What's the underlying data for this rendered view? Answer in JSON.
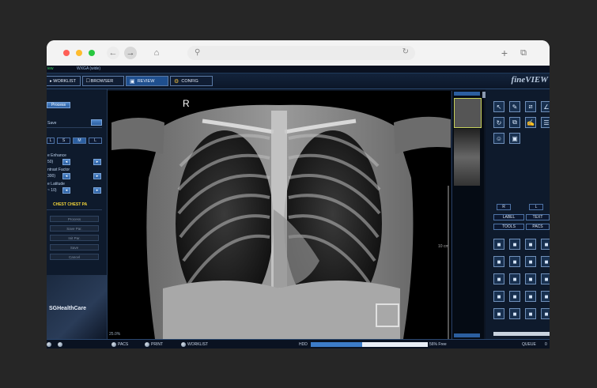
{
  "app": {
    "brand": "fineVIEW",
    "top_strip_left": "iew",
    "top_strip_center": "WXGA (wide)"
  },
  "tabs": [
    "WORKLIST",
    "BROWSER",
    "REVIEW",
    "CONFIG"
  ],
  "left_panel": {
    "process": "Process",
    "save": "Save",
    "size_buttons": [
      "L",
      "S",
      "M",
      "L"
    ],
    "fields": [
      {
        "label": "e Enhance",
        "value": "50)"
      },
      {
        "label": "ntrast Factor",
        "value": "300)"
      },
      {
        "label": "e Latitude",
        "value": "~ 10)"
      }
    ],
    "protocol": "CHEST CHEST PA",
    "actions": [
      "Process",
      "Save Par.",
      "Init Par.",
      "Save",
      "Cancel"
    ],
    "logo": "SGHealthCare"
  },
  "viewer": {
    "marker": "R",
    "zoom": "25.0%",
    "ruler": "10 cm"
  },
  "right_panel": {
    "l_r": [
      "R",
      "L"
    ],
    "labels": [
      "LABEL",
      "TEXT",
      "TOOLS",
      "PACS"
    ],
    "tools": [
      "pointer-icon",
      "marker-icon",
      "measure-icon",
      "angle-icon",
      "rotate-icon",
      "copy-icon",
      "annotate-icon",
      "layers-icon",
      "person-icon",
      "monitor-icon"
    ],
    "bottom_tools": [
      "layout-icon",
      "grid-icon",
      "tile-icon",
      "fit-icon",
      "user-icon",
      "wand-icon",
      "flip-icon",
      "move-icon",
      "image-icon",
      "portrait-icon",
      "film-icon",
      "brightness-icon",
      "hand-icon",
      "cube-icon",
      "warning-icon",
      "ruler-icon",
      "zoom-icon",
      "stack-icon",
      "export-icon",
      "arrow-icon"
    ]
  },
  "status": {
    "items": [
      "PACS",
      "PRINT",
      "WORKLIST"
    ],
    "hdd_label": "HDD",
    "hdd_free": "56% Free",
    "hdd_used_fraction": 0.44,
    "queue_label": "QUEUE",
    "queue_value": "0"
  }
}
